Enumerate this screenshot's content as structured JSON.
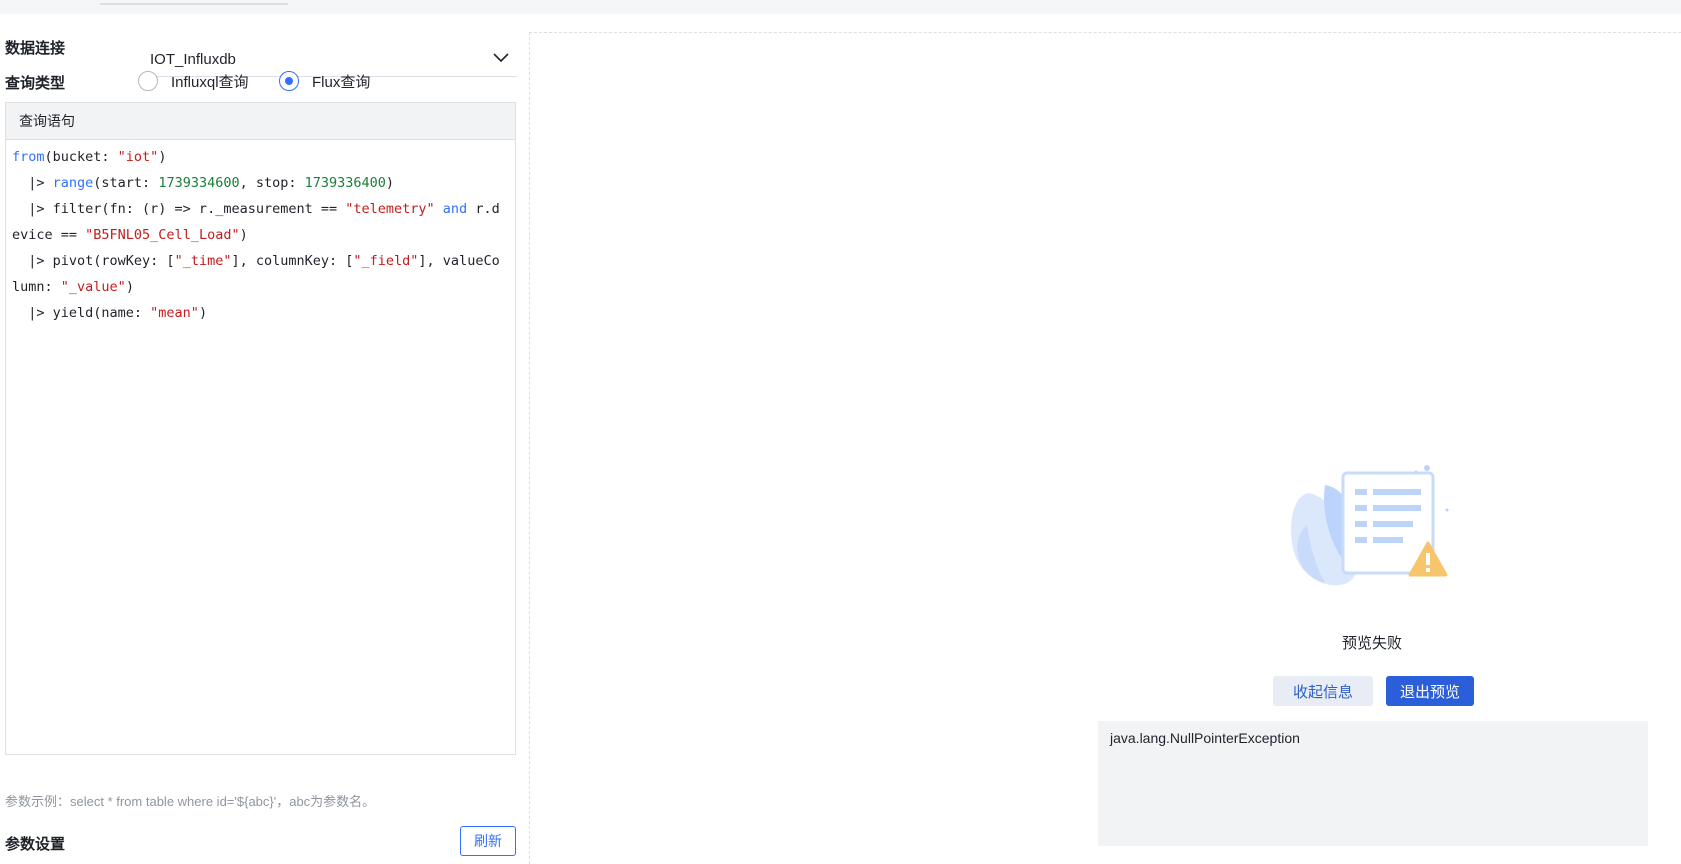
{
  "form": {
    "connection_label": "数据连接",
    "connection_value": "IOT_Influxdb",
    "query_type_label": "查询类型",
    "query_types": [
      {
        "label": "Influxql查询",
        "checked": false
      },
      {
        "label": "Flux查询",
        "checked": true
      }
    ]
  },
  "editor": {
    "header": "查询语句",
    "code": {
      "l1_a": "from",
      "l1_b": "(bucket: ",
      "l1_c": "\"iot\"",
      "l1_d": ")",
      "l2_a": "  |> ",
      "l2_b": "range",
      "l2_c": "(start: ",
      "l2_d": "1739334600",
      "l2_e": ", stop: ",
      "l2_f": "1739336400",
      "l2_g": ")",
      "l3_a": "  |> filter(fn: (r) => r._measurement == ",
      "l3_b": "\"telemetry\"",
      "l3_c": " ",
      "l3_d": "and",
      "l3_e": " r.d",
      "l4_a": "evice == ",
      "l4_b": "\"B5FNL05_Cell_Load\"",
      "l4_c": ")",
      "l5_a": "  |> pivot(rowKey: [",
      "l5_b": "\"_time\"",
      "l5_c": "], columnKey: [",
      "l5_d": "\"_field\"",
      "l5_e": "], valueCo",
      "l6_a": "lumn: ",
      "l6_b": "\"_value\"",
      "l6_c": ")",
      "l7_a": "  |> yield(name: ",
      "l7_b": "\"mean\"",
      "l7_c": ")"
    }
  },
  "params": {
    "hint": "参数示例：select * from table where id='${abc}'，abc为参数名。",
    "title": "参数设置",
    "refresh_label": "刷新"
  },
  "preview": {
    "fail_text": "预览失败",
    "collapse_label": "收起信息",
    "exit_label": "退出预览",
    "error_message": "java.lang.NullPointerException"
  },
  "colors": {
    "accent": "#3370ff",
    "primary_button": "#2b5fd9",
    "string": "#c41d1d",
    "number": "#1a7f37"
  }
}
